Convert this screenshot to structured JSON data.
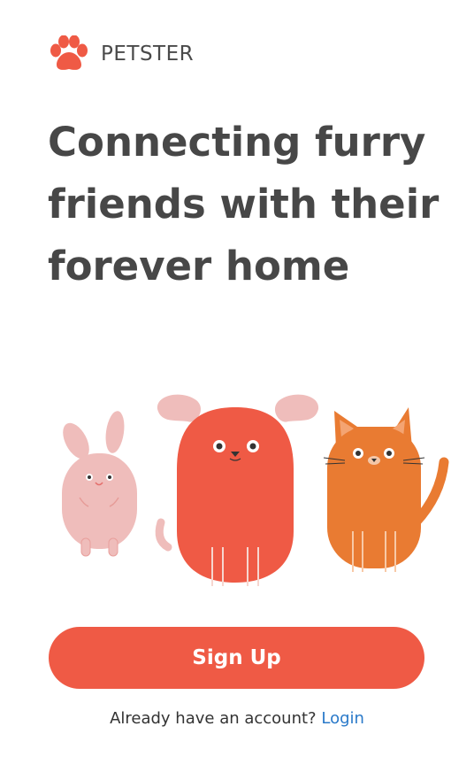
{
  "brand": {
    "logo_icon": "paw-icon",
    "name": "PETSTER",
    "accent_color": "#ef5a45"
  },
  "hero": {
    "headline": "Connecting furry friends with their forever home"
  },
  "illustration": {
    "characters": [
      "rabbit",
      "dog",
      "cat"
    ]
  },
  "actions": {
    "signup_label": "Sign Up",
    "account_prompt": "Already have an account?",
    "login_label": "Login",
    "link_color": "#2979c9"
  }
}
